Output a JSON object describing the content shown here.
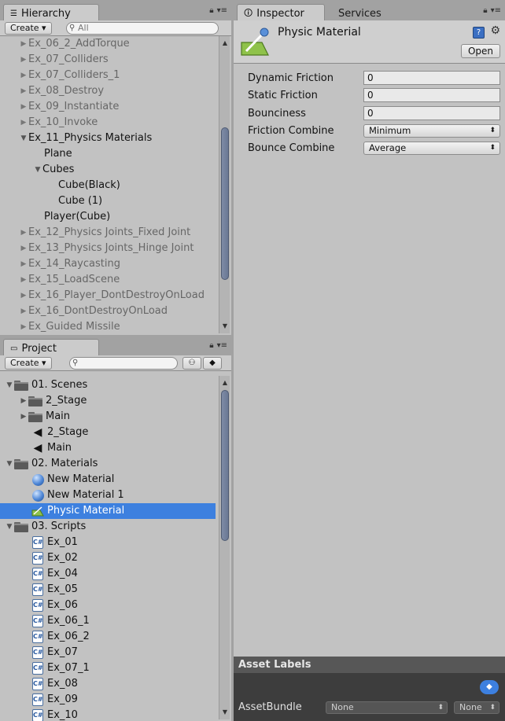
{
  "hierarchy": {
    "tab_label": "Hierarchy",
    "create_label": "Create",
    "search_placeholder": "All",
    "items": [
      {
        "label": "Ex_06_2_AddTorque",
        "expanded": false
      },
      {
        "label": "Ex_07_Colliders",
        "expanded": false
      },
      {
        "label": "Ex_07_Colliders_1",
        "expanded": false
      },
      {
        "label": "Ex_08_Destroy",
        "expanded": false
      },
      {
        "label": "Ex_09_Instantiate",
        "expanded": false
      },
      {
        "label": "Ex_10_Invoke",
        "expanded": false
      },
      {
        "label": "Ex_11_Physics Materials",
        "expanded": true
      },
      {
        "label": "Plane"
      },
      {
        "label": "Cubes",
        "expanded": true
      },
      {
        "label": "Cube(Black)"
      },
      {
        "label": "Cube (1)"
      },
      {
        "label": "Player(Cube)"
      },
      {
        "label": "Ex_12_Physics Joints_Fixed Joint",
        "expanded": false
      },
      {
        "label": "Ex_13_Physics Joints_Hinge Joint",
        "expanded": false
      },
      {
        "label": "Ex_14_Raycasting",
        "expanded": false
      },
      {
        "label": "Ex_15_LoadScene",
        "expanded": false
      },
      {
        "label": "Ex_16_Player_DontDestroyOnLoad",
        "expanded": false
      },
      {
        "label": "Ex_16_DontDestroyOnLoad",
        "expanded": false
      },
      {
        "label": "Ex_Guided Missile",
        "expanded": false
      }
    ]
  },
  "project": {
    "tab_label": "Project",
    "create_label": "Create",
    "search_placeholder": "",
    "items": [
      {
        "label": "01. Scenes",
        "icon": "folder-icon"
      },
      {
        "label": "2_Stage",
        "icon": "folder-icon"
      },
      {
        "label": "Main",
        "icon": "folder-icon"
      },
      {
        "label": "2_Stage",
        "icon": "unity-scene-icon"
      },
      {
        "label": "Main",
        "icon": "unity-scene-icon"
      },
      {
        "label": "02. Materials",
        "icon": "folder-icon"
      },
      {
        "label": "New Material",
        "icon": "material-sphere-icon"
      },
      {
        "label": "New Material 1",
        "icon": "material-sphere-icon"
      },
      {
        "label": "Physic Material",
        "icon": "physic-material-icon",
        "selected": true
      },
      {
        "label": "03. Scripts",
        "icon": "folder-icon"
      },
      {
        "label": "Ex_01",
        "icon": "csharp-script-icon"
      },
      {
        "label": "Ex_02",
        "icon": "csharp-script-icon"
      },
      {
        "label": "Ex_04",
        "icon": "csharp-script-icon"
      },
      {
        "label": "Ex_05",
        "icon": "csharp-script-icon"
      },
      {
        "label": "Ex_06",
        "icon": "csharp-script-icon"
      },
      {
        "label": "Ex_06_1",
        "icon": "csharp-script-icon"
      },
      {
        "label": "Ex_06_2",
        "icon": "csharp-script-icon"
      },
      {
        "label": "Ex_07",
        "icon": "csharp-script-icon"
      },
      {
        "label": "Ex_07_1",
        "icon": "csharp-script-icon"
      },
      {
        "label": "Ex_08",
        "icon": "csharp-script-icon"
      },
      {
        "label": "Ex_09",
        "icon": "csharp-script-icon"
      },
      {
        "label": "Ex_10",
        "icon": "csharp-script-icon"
      }
    ]
  },
  "inspector": {
    "tab_label": "Inspector",
    "services_tab_label": "Services",
    "asset_name": "Physic Material",
    "open_label": "Open",
    "properties": {
      "dynamic_friction": {
        "label": "Dynamic Friction",
        "value": "0"
      },
      "static_friction": {
        "label": "Static Friction",
        "value": "0"
      },
      "bounciness": {
        "label": "Bounciness",
        "value": "0"
      },
      "friction_combine": {
        "label": "Friction Combine",
        "value": "Minimum"
      },
      "bounce_combine": {
        "label": "Bounce Combine",
        "value": "Average"
      }
    },
    "asset_labels_title": "Asset Labels",
    "asset_bundle_label": "AssetBundle",
    "asset_bundle_value": "None",
    "asset_bundle_variant": "None"
  },
  "colors": {
    "selection": "#3d80df",
    "panel_bg": "#c2c2c2",
    "scroll_thumb": "#6a7894"
  }
}
